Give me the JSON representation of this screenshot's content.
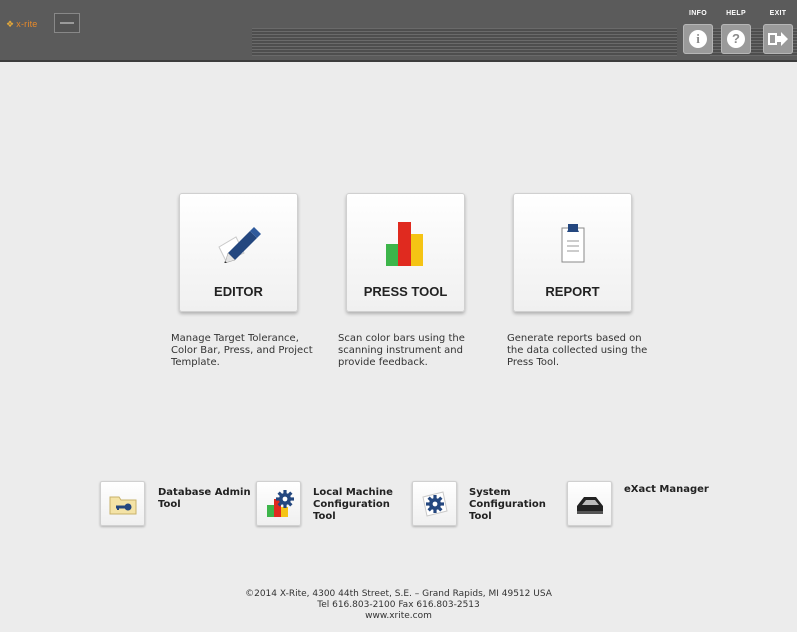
{
  "header": {
    "logo_text": "x-rite",
    "buttons": [
      {
        "label": "INFO",
        "icon": "info-icon"
      },
      {
        "label": "HELP",
        "icon": "help-icon"
      },
      {
        "label": "EXIT",
        "icon": "exit-icon"
      }
    ],
    "info_glyph": "i",
    "help_glyph": "?"
  },
  "main_tools": [
    {
      "label": "EDITOR",
      "icon": "pen-icon",
      "description": "Manage Target Tolerance, Color Bar, Press, and Project Template."
    },
    {
      "label": "PRESS TOOL",
      "icon": "bar-chart-icon",
      "description": "Scan color bars using the scanning instrument and provide feedback."
    },
    {
      "label": "REPORT",
      "icon": "clipboard-icon",
      "description": "Generate reports based on the data collected using the Press Tool."
    }
  ],
  "secondary_tools": [
    {
      "label": "Database Admin Tool",
      "icon": "folder-key-icon"
    },
    {
      "label": "Local Machine Configuration Tool",
      "icon": "gear-bars-icon"
    },
    {
      "label": "System Configuration Tool",
      "icon": "gear-icon"
    },
    {
      "label": "eXact Manager",
      "icon": "device-icon"
    }
  ],
  "footer": {
    "line1": "©2014 X-Rite, 4300 44th Street, S.E. – Grand Rapids, MI  49512 USA",
    "line2": "Tel 616.803-2100 Fax 616.803-2513",
    "line3": "www.xrite.com"
  },
  "colors": {
    "header_bg": "#5b5b5b",
    "page_bg": "#ececec",
    "icon_blue": "#24477f",
    "bar_red": "#e02a1f",
    "bar_green": "#3db54a",
    "bar_yellow": "#f5c414",
    "logo_orange": "#e88a2a"
  }
}
